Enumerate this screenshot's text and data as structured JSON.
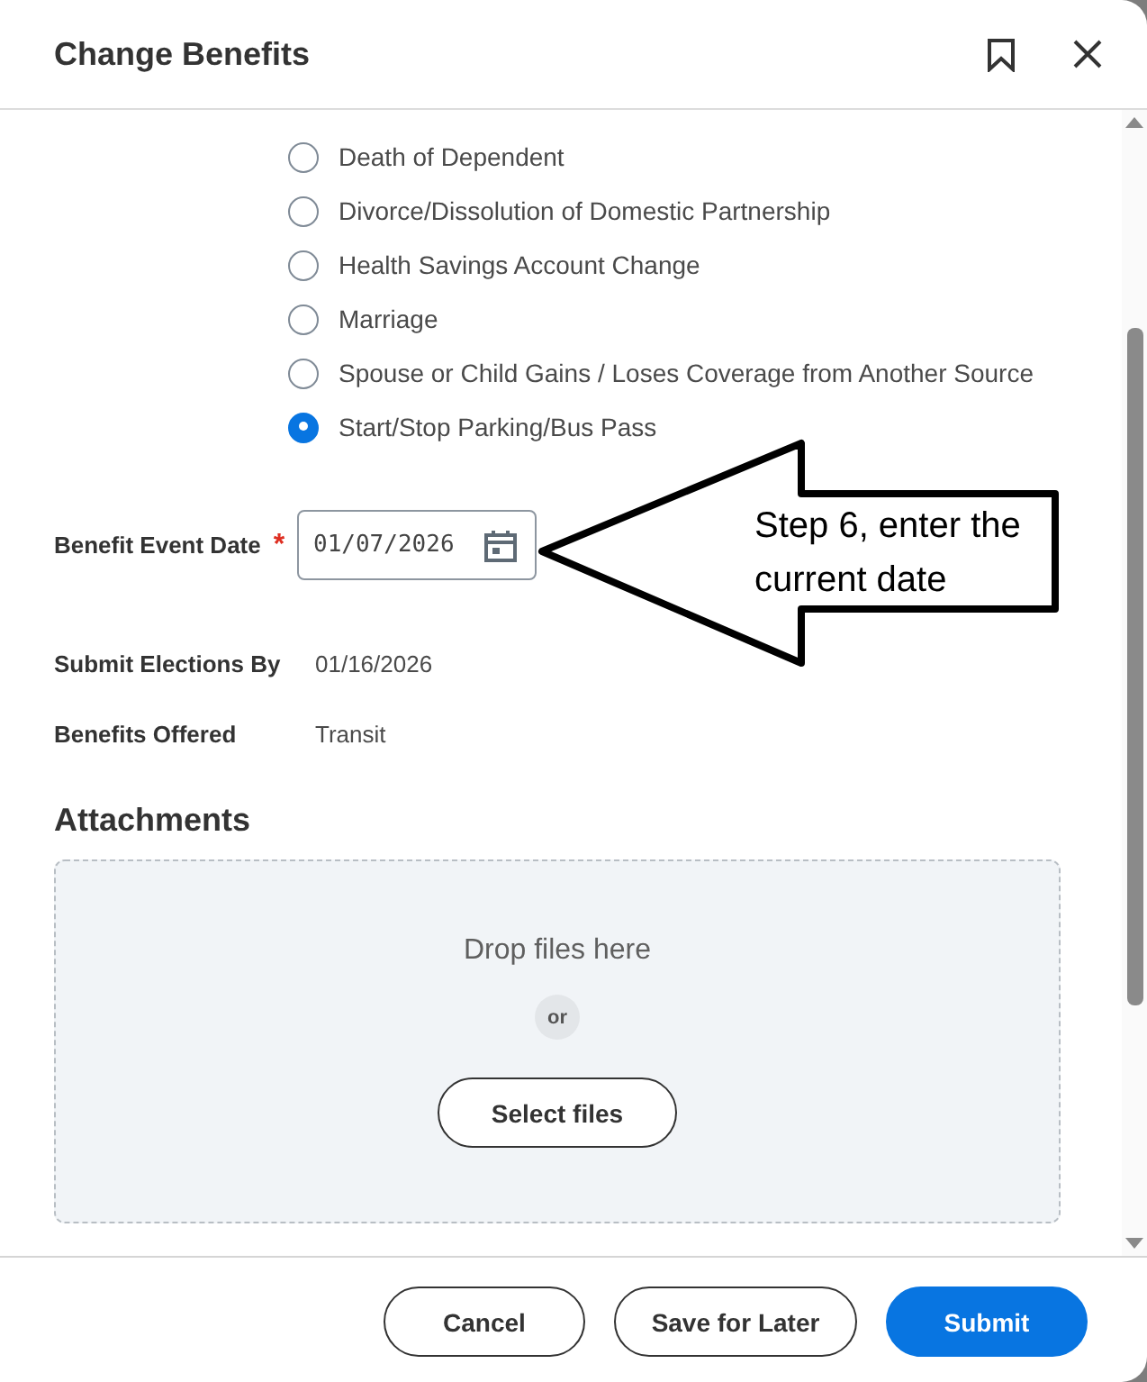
{
  "dialog": {
    "title": "Change Benefits"
  },
  "event_reasons": [
    {
      "label": "Death of Dependent",
      "selected": false
    },
    {
      "label": "Divorce/Dissolution of Domestic Partnership",
      "selected": false
    },
    {
      "label": "Health Savings Account Change",
      "selected": false
    },
    {
      "label": "Marriage",
      "selected": false
    },
    {
      "label": "Spouse or Child Gains / Loses Coverage from Another Source",
      "selected": false
    },
    {
      "label": "Start/Stop Parking/Bus Pass",
      "selected": true
    }
  ],
  "fields": [
    {
      "kind": "date",
      "label": "Benefit Event Date",
      "required_mark": "*",
      "value": "01/07/2026"
    },
    {
      "kind": "text",
      "label": "Submit Elections By",
      "value": "01/16/2026"
    },
    {
      "kind": "text",
      "label": "Benefits Offered",
      "value": "Transit"
    }
  ],
  "callout": {
    "text": "Step 6, enter the current date"
  },
  "attachments": {
    "heading": "Attachments",
    "drop_text": "Drop files here",
    "or_text": "or",
    "button": "Select files"
  },
  "footer_buttons": [
    {
      "label": "Cancel",
      "kind": "secondary"
    },
    {
      "label": "Save for Later",
      "kind": "secondary"
    },
    {
      "label": "Submit",
      "kind": "primary"
    }
  ]
}
